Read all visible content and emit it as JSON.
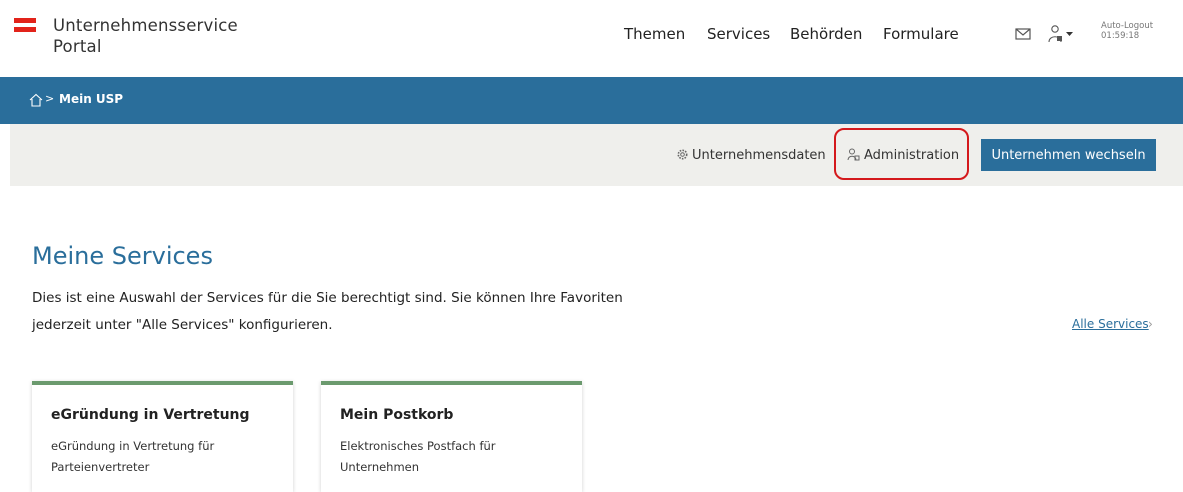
{
  "header": {
    "logo_line1": "Unternehmensservice",
    "logo_line2": "Portal",
    "nav": [
      "Themen",
      "Services",
      "Behörden",
      "Formulare"
    ],
    "auto_logout_label": "Auto-Logout",
    "auto_logout_time": "01:59:18",
    "icons": [
      "mail-icon",
      "user-icon",
      "caret-down-icon"
    ]
  },
  "breadcrumb": {
    "home_icon": "home-icon",
    "separator": ">",
    "current": "Mein USP"
  },
  "toolbar": {
    "company_data": "Unternehmensdaten",
    "administration": "Administration",
    "switch_company": "Unternehmen wechseln"
  },
  "main": {
    "title": "Meine Services",
    "description": "Dies ist eine Auswahl der Services für die Sie berechtigt sind. Sie können Ihre Favoriten jederzeit unter \"Alle Services\" konfigurieren.",
    "all_services": "Alle Services",
    "all_services_chevron": "›",
    "cards": [
      {
        "title": "eGründung in Vertretung",
        "description": "eGründung in Vertretung für Parteienvertreter"
      },
      {
        "title": "Mein Postkorb",
        "description": "Elektronisches Postfach für Unternehmen"
      }
    ]
  },
  "colors": {
    "primary": "#2a6e9b",
    "brand_red": "#e2231a",
    "card_accent": "#6b9a6e",
    "highlight_red": "#d4191c",
    "toolbar_bg": "#efefec"
  }
}
